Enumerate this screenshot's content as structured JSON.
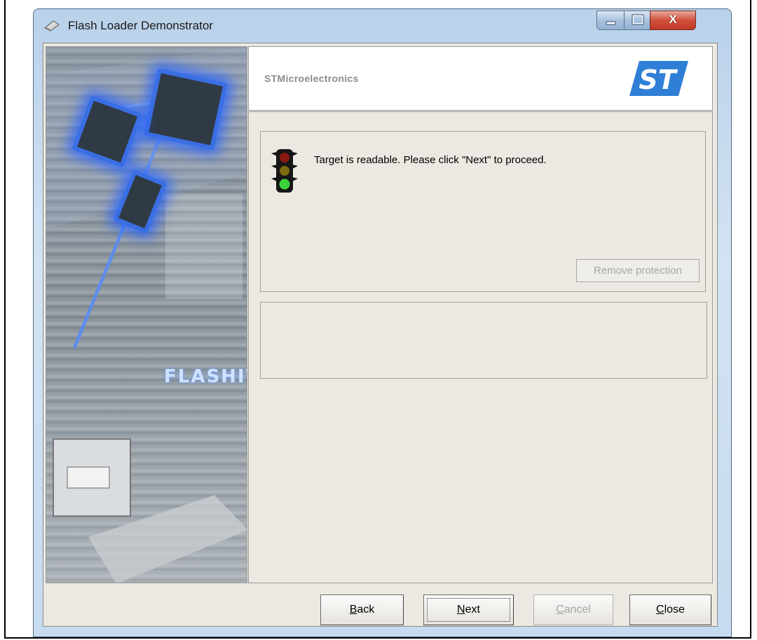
{
  "window": {
    "title": "Flash Loader Demonstrator",
    "controls": {
      "minimize_icon": "minimize-icon",
      "maximize_icon": "maximize-icon",
      "close_label": "X"
    }
  },
  "side_image": {
    "caption": "FLASHIT"
  },
  "header": {
    "company": "STMicroelectronics",
    "logo_text": "ST",
    "logo_color": "#2f7fd6"
  },
  "status": {
    "icon": "traffic-light-icon",
    "message": "Target is readable. Please click \"Next\" to proceed.",
    "remove_protection_label": "Remove protection"
  },
  "buttons": {
    "back": {
      "label": "Back",
      "mnemonic": "B",
      "rest": "ack"
    },
    "next": {
      "label": "Next",
      "mnemonic": "N",
      "rest": "ext"
    },
    "cancel": {
      "label": "Cancel",
      "mnemonic": "C",
      "rest": "ancel"
    },
    "close": {
      "label": "Close",
      "mnemonic": "C",
      "rest": "lose"
    }
  },
  "colors": {
    "titlebar": "#b9d1ea",
    "close_button": "#c8452f",
    "light_red": "#8b1a10",
    "light_amber": "#7a6a10",
    "light_green": "#3cd23c"
  }
}
